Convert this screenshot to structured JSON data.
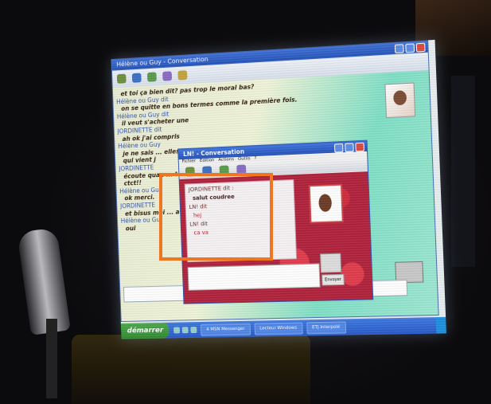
{
  "main_window": {
    "title": "Hélène ou Guy - Conversation",
    "chat": [
      {
        "kind": "msg",
        "text": "et toi ça bien dit? pas trop le moral bas?"
      },
      {
        "kind": "who",
        "text": "Hélène ou Guy dit"
      },
      {
        "kind": "msg",
        "text": "on se quitte en bons termes comme la première fois."
      },
      {
        "kind": "who",
        "text": "Hélène ou Guy dit"
      },
      {
        "kind": "msg",
        "text": "il veut s'acheter une"
      },
      {
        "kind": "who",
        "text": "JORDINETTE dit"
      },
      {
        "kind": "msg",
        "text": "ah ok j'ai compris"
      },
      {
        "kind": "who",
        "text": "Hélène ou Guy"
      },
      {
        "kind": "msg",
        "text": "je ne sais ... elles"
      },
      {
        "kind": "msg",
        "text": "qui vient j"
      },
      {
        "kind": "who",
        "text": "JORDINETTE"
      },
      {
        "kind": "msg",
        "text": "écoute quan ... tout le vre"
      },
      {
        "kind": "msg",
        "text": "ctct!!"
      },
      {
        "kind": "who",
        "text": "Hélène ou Gu"
      },
      {
        "kind": "msg",
        "text": "ok merci."
      },
      {
        "kind": "who",
        "text": "JORDINETTE"
      },
      {
        "kind": "msg",
        "text": "et bisus moi ... avarant!"
      },
      {
        "kind": "who",
        "text": "Hélène ou Gu"
      },
      {
        "kind": "msg",
        "text": "oui"
      }
    ]
  },
  "popup_window": {
    "title": "LN! - Conversation",
    "menu": [
      "Fichier",
      "Édition",
      "Actions",
      "Outils",
      "?"
    ],
    "chat": [
      {
        "kind": "who",
        "text": "JORDINETTE dit :"
      },
      {
        "kind": "msg",
        "style": "dark",
        "text": "salut coudree"
      },
      {
        "kind": "who",
        "text": "LN! dit"
      },
      {
        "kind": "msg",
        "text": "hej"
      },
      {
        "kind": "who",
        "text": "LN! dit"
      },
      {
        "kind": "msg",
        "text": "ca va"
      }
    ],
    "send_label": "Envoyer"
  },
  "taskbar": {
    "start_label": "démarrer",
    "tasks": [
      "4 MSN Messenger",
      "Lecteur Windows",
      "ETJ Interpolé"
    ]
  }
}
